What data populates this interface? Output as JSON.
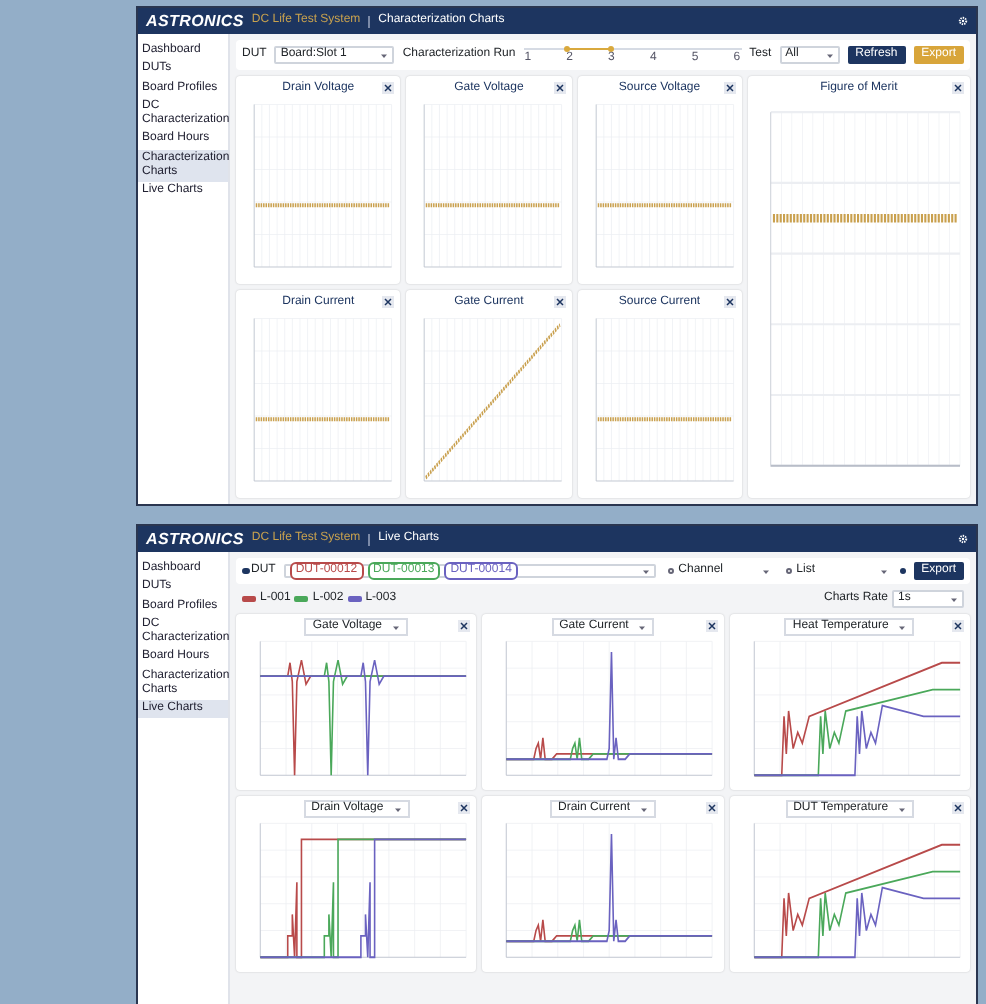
{
  "characterization_window": {
    "logo": "ASTRONICS",
    "app_name": "DC Life Test System",
    "page_title": "Characterization Charts",
    "sidebar": [
      {
        "label": "Dashboard",
        "selected": false
      },
      {
        "label": "DUTs",
        "selected": false
      },
      {
        "label": "Board Profiles",
        "selected": false
      },
      {
        "label": "DC Characterization",
        "selected": false
      },
      {
        "label": "Board Hours",
        "selected": false
      },
      {
        "label": "Characterization Charts",
        "selected": true
      },
      {
        "label": "Live Charts",
        "selected": false
      }
    ],
    "toolbar": {
      "dut_label": "DUT",
      "dut_value": "Board:Slot 1",
      "run_label": "Characterization Run",
      "ticks": [
        "1",
        "2",
        "3",
        "4",
        "5",
        "6"
      ],
      "thumbs": [
        {
          "level": 0.2
        },
        {
          "level": 0.4
        }
      ],
      "test_label": "Test",
      "test_value": "All",
      "buttons": [
        {
          "label": "Refresh",
          "kind": "primary"
        },
        {
          "label": "Export",
          "kind": "warning"
        }
      ]
    },
    "charts": [
      {
        "title": "Drain Voltage",
        "kind": "flat"
      },
      {
        "title": "Gate Voltage",
        "kind": "flat"
      },
      {
        "title": "Source Voltage",
        "kind": "flat"
      },
      {
        "title": "Figure of Merit",
        "kind": "tall"
      },
      {
        "title": "Drain Current",
        "kind": "flat"
      },
      {
        "title": "Gate Current",
        "kind": "ramp"
      },
      {
        "title": "Source Current",
        "kind": "flat"
      }
    ]
  },
  "live_window": {
    "logo": "ASTRONICS",
    "app_name": "DC Life Test System",
    "page_title": "Live Charts",
    "sidebar": [
      {
        "label": "Dashboard",
        "selected": false
      },
      {
        "label": "DUTs",
        "selected": false
      },
      {
        "label": "Board Profiles",
        "selected": false
      },
      {
        "label": "DC Characterization",
        "selected": false
      },
      {
        "label": "Board Hours",
        "selected": false
      },
      {
        "label": "Characterization Charts",
        "selected": false
      },
      {
        "label": "Live Charts",
        "selected": true
      }
    ],
    "modes": [
      {
        "label": "DUT",
        "selected": true
      },
      {
        "label": "Channel",
        "selected": false
      },
      {
        "label": "List",
        "selected": false
      }
    ],
    "duts": [
      {
        "label": "DUT-00012",
        "color": "#b84a4a"
      },
      {
        "label": "DUT-00013",
        "color": "#4aa85a"
      },
      {
        "label": "DUT-00014",
        "color": "#6a62c0"
      }
    ],
    "legend": [
      {
        "label": "L-001",
        "color": "#b84a4a"
      },
      {
        "label": "L-002",
        "color": "#4aa85a"
      },
      {
        "label": "L-003",
        "color": "#6a62c0"
      }
    ],
    "export_label": "Export",
    "rate_label": "Charts Rate",
    "rate_value": "1s",
    "charts": [
      {
        "title": "Gate Voltage",
        "kind": "dip"
      },
      {
        "title": "Gate Current",
        "kind": "spike"
      },
      {
        "title": "Heat Temperature",
        "kind": "ramp"
      },
      {
        "title": "Drain Voltage",
        "kind": "step"
      },
      {
        "title": "Drain Current",
        "kind": "spike"
      },
      {
        "title": "DUT Temperature",
        "kind": "ramp"
      }
    ]
  }
}
